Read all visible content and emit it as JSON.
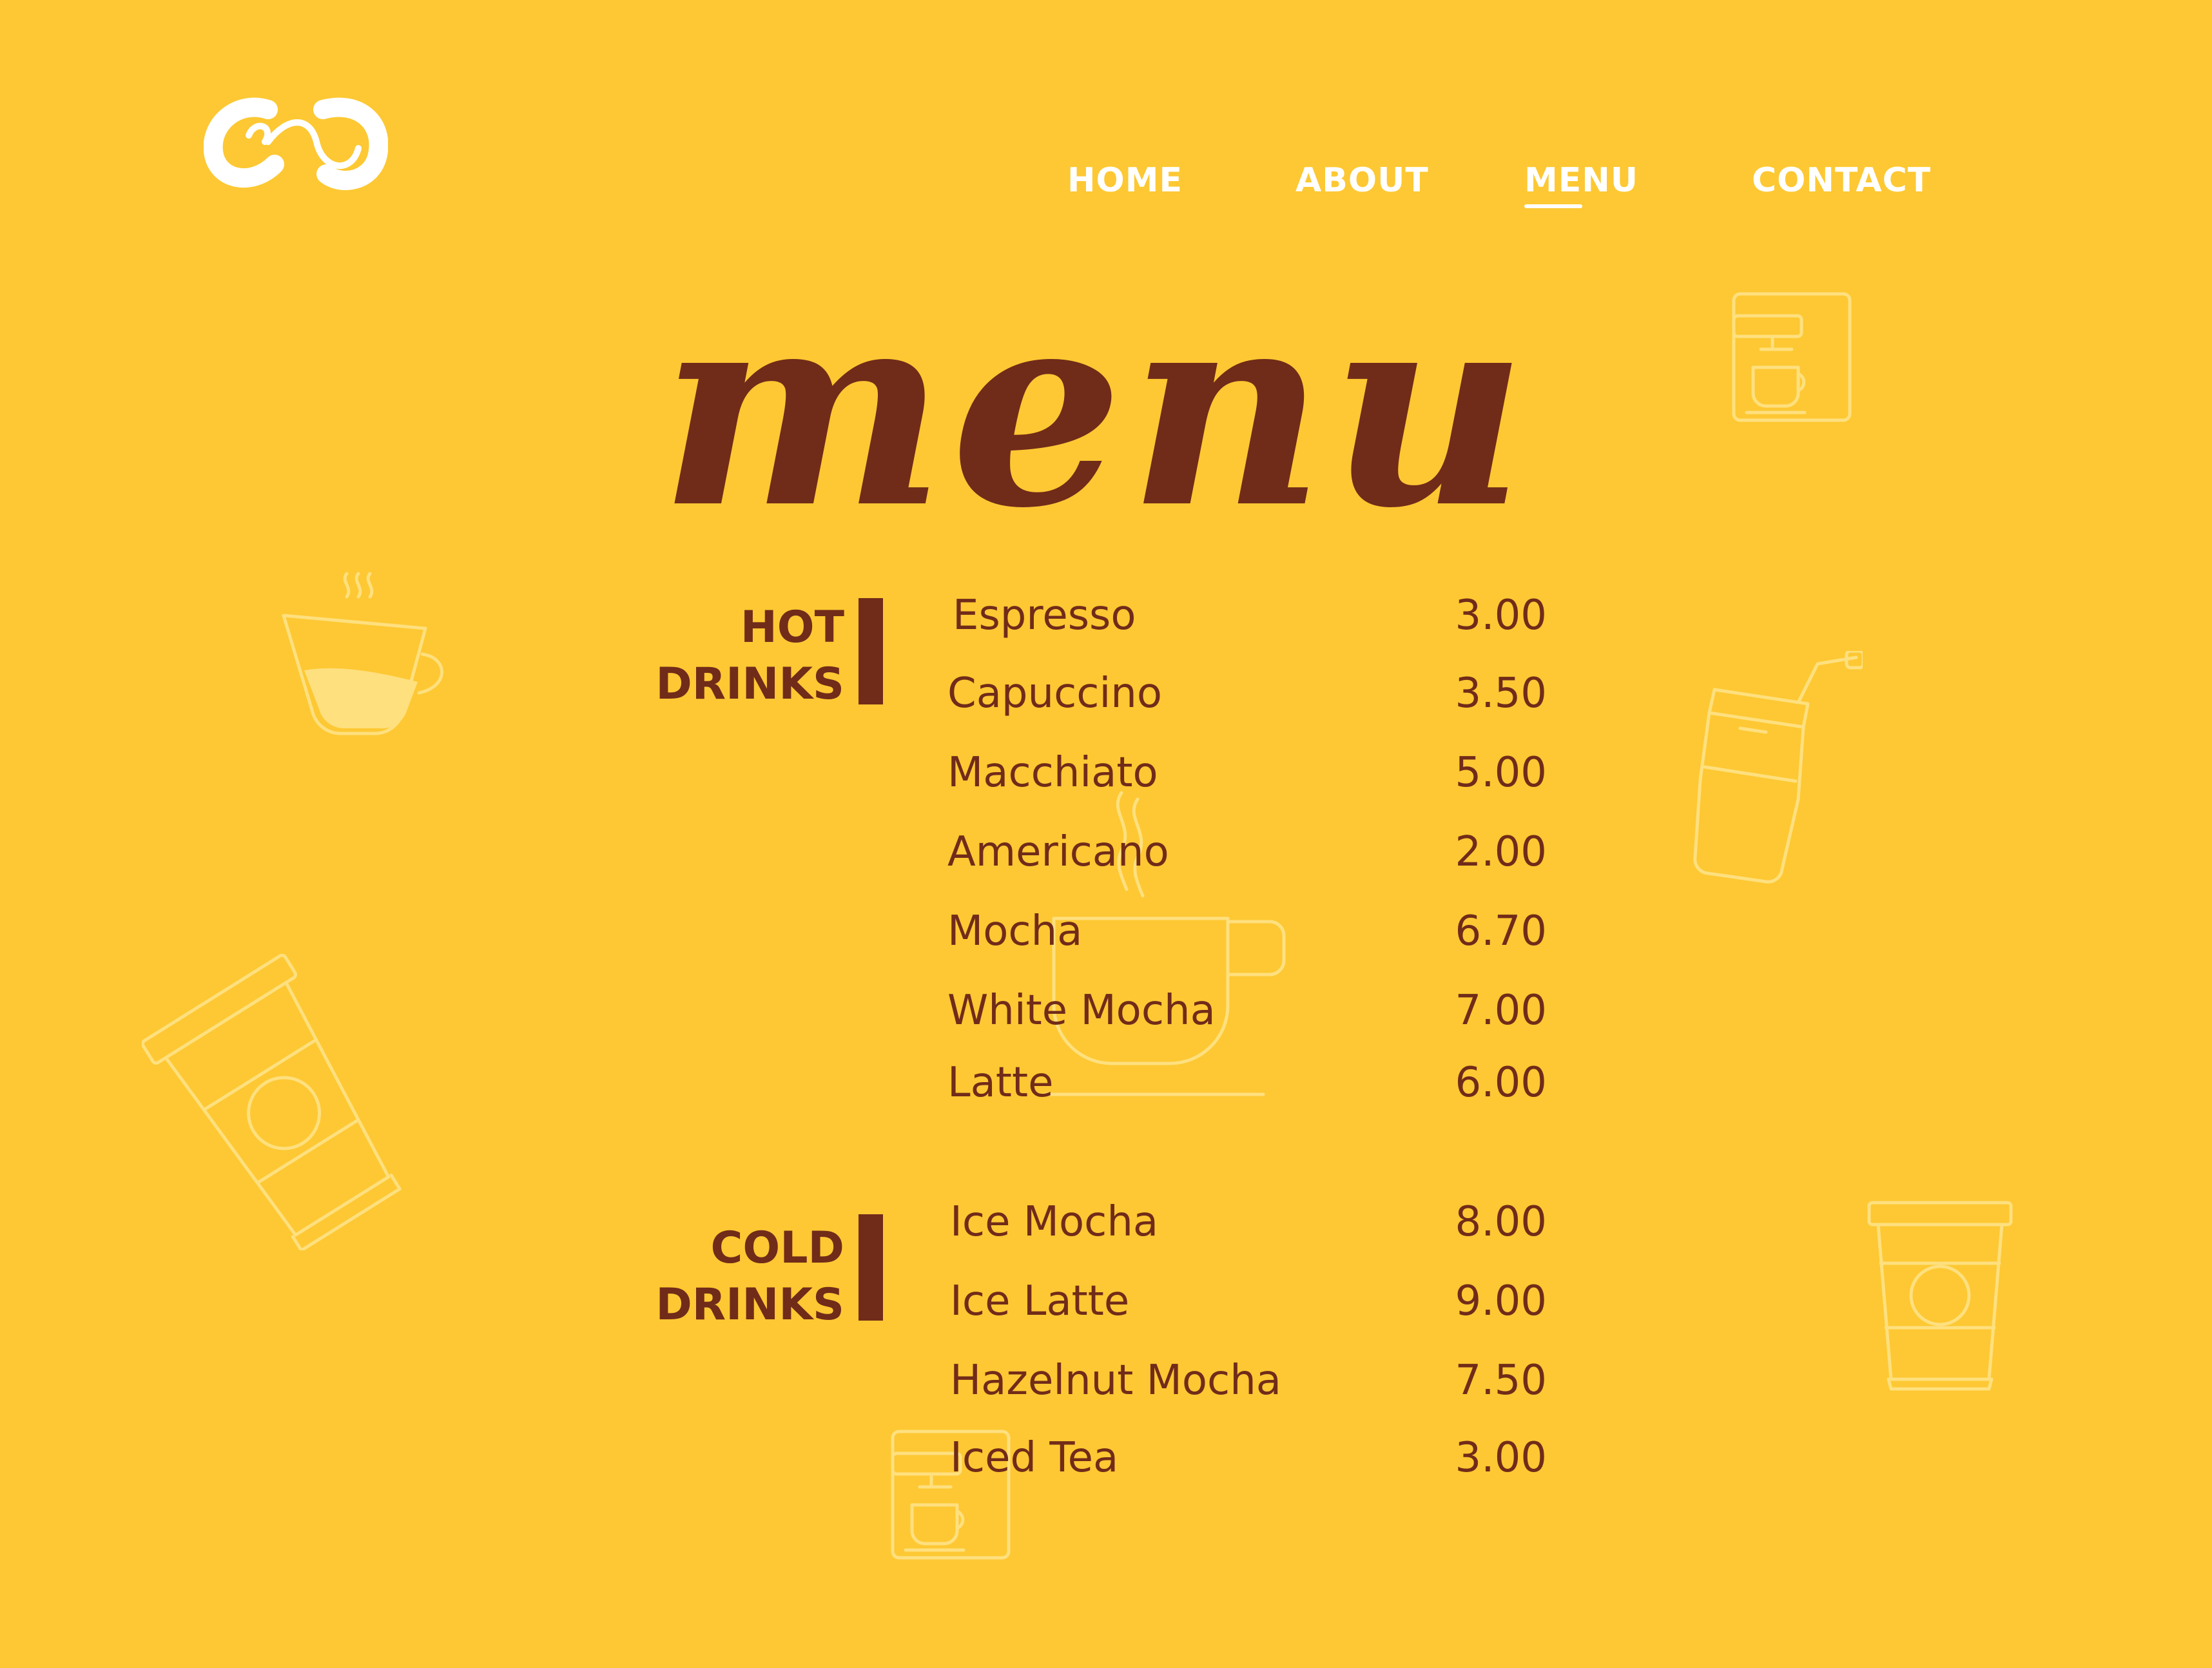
{
  "brand": {
    "logo_icon": "cafe-monogram-logo",
    "text_color": "#FFFFFF"
  },
  "nav": {
    "items": [
      {
        "label": "HOME",
        "active": false
      },
      {
        "label": "ABOUT",
        "active": false
      },
      {
        "label": "MENU",
        "active": true
      },
      {
        "label": "CONTACT",
        "active": false
      }
    ]
  },
  "main": {
    "title": "menu",
    "categories": [
      {
        "heading_line1": "HOT",
        "heading_line2": "DRINKS",
        "items": [
          {
            "name": "Espresso",
            "price": "3.00"
          },
          {
            "name": "Capuccino",
            "price": "3.50"
          },
          {
            "name": "Macchiato",
            "price": "5.00"
          },
          {
            "name": "Americano",
            "price": "2.00"
          },
          {
            "name": "Mocha",
            "price": "6.70"
          },
          {
            "name": "White Mocha",
            "price": "7.00"
          },
          {
            "name": "Latte",
            "price": "6.00"
          }
        ]
      },
      {
        "heading_line1": "COLD",
        "heading_line2": "DRINKS",
        "items": [
          {
            "name": "Ice Mocha",
            "price": "8.00"
          },
          {
            "name": "Ice Latte",
            "price": "9.00"
          },
          {
            "name": "Hazelnut Mocha",
            "price": "7.50"
          },
          {
            "name": "Iced Tea",
            "price": "3.00"
          }
        ]
      }
    ]
  },
  "background_icons": [
    "coffee-machine-icon",
    "coffee-cup-icon",
    "coffee-grinder-icon",
    "takeaway-cup-icon"
  ],
  "colors": {
    "background": "#FDC833",
    "accent": "#712B19",
    "icon_tint": "#FFE07F"
  }
}
